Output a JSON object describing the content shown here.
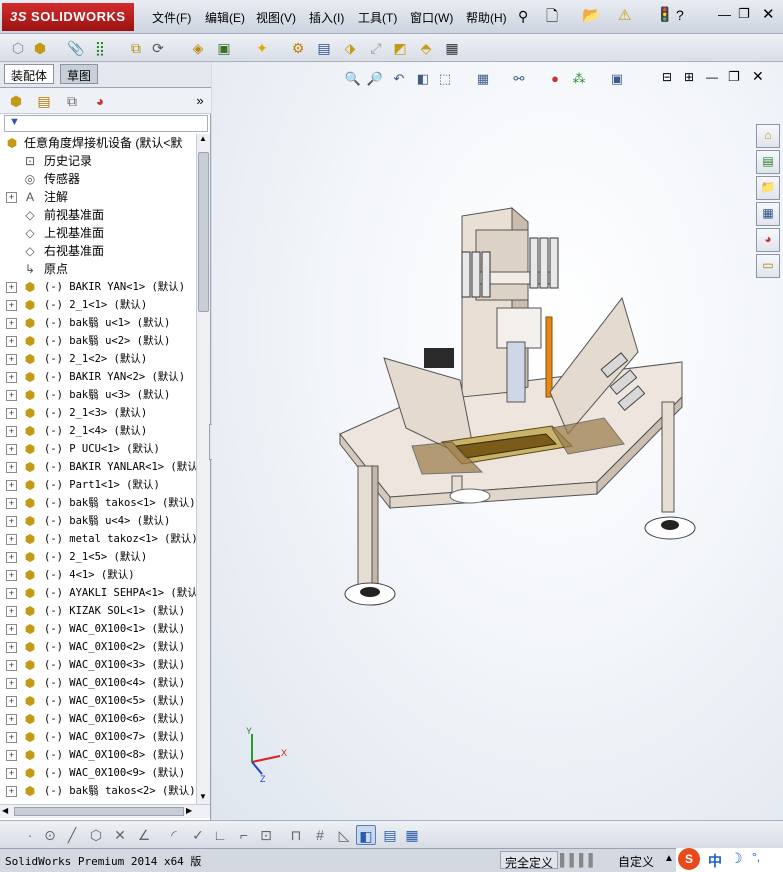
{
  "app": {
    "logo_text": "SOLIDWORKS",
    "logo_prefix": "3S"
  },
  "menu": [
    {
      "label": "文件(F)"
    },
    {
      "label": "编辑(E)"
    },
    {
      "label": "视图(V)"
    },
    {
      "label": "插入(I)"
    },
    {
      "label": "工具(T)"
    },
    {
      "label": "窗口(W)"
    },
    {
      "label": "帮助(H)"
    }
  ],
  "tabs": {
    "assembly": "装配体",
    "sketch": "草图"
  },
  "tree": {
    "root": "任意角度焊接机设备  (默认<默",
    "top_items": [
      {
        "label": "历史记录",
        "icon": "history-icon"
      },
      {
        "label": "传感器",
        "icon": "sensor-icon"
      },
      {
        "label": "注解",
        "icon": "annotation-icon"
      },
      {
        "label": "前视基准面",
        "icon": "plane-icon"
      },
      {
        "label": "上视基准面",
        "icon": "plane-icon"
      },
      {
        "label": "右视基准面",
        "icon": "plane-icon"
      },
      {
        "label": "原点",
        "icon": "origin-icon"
      }
    ],
    "parts": [
      "(-) BAKIR YAN<1> (默认)",
      "(-) 2_1<1> (默认)",
      "(-) bak翳 u<1> (默认)",
      "(-) bak翳 u<2> (默认)",
      "(-) 2_1<2> (默认)",
      "(-) BAKIR YAN<2> (默认)",
      "(-) bak翳 u<3> (默认)",
      "(-) 2_1<3> (默认)",
      "(-) 2_1<4> (默认)",
      "(-) P UCU<1> (默认)",
      "(-) BAKIR YANLAR<1> (默认",
      "(-) Part1<1> (默认)",
      "(-) bak翳 takos<1> (默认)",
      "(-) bak翳 u<4> (默认)",
      "(-) metal takoz<1> (默认)",
      "(-) 2_1<5> (默认)",
      "(-) 4<1> (默认)",
      "(-) AYAKLI SEHPA<1> (默认",
      "(-) KIZAK SOL<1> (默认)",
      "(-) WAC_0X100<1> (默认)",
      "(-) WAC_0X100<2> (默认)",
      "(-) WAC_0X100<3> (默认)",
      "(-) WAC_0X100<4> (默认)",
      "(-) WAC_0X100<5> (默认)",
      "(-) WAC_0X100<6> (默认)",
      "(-) WAC_0X100<7> (默认)",
      "(-) WAC_0X100<8> (默认)",
      "(-) WAC_0X100<9> (默认)",
      "(-) bak翳 takos<2> (默认)"
    ]
  },
  "triad": {
    "x": "X",
    "y": "Y",
    "z": "Z"
  },
  "status": {
    "product": "SolidWorks Premium 2014 x64 版",
    "definition": "完全定义",
    "custom": "自定义"
  },
  "ime": {
    "logo": "S",
    "mode": "中"
  }
}
